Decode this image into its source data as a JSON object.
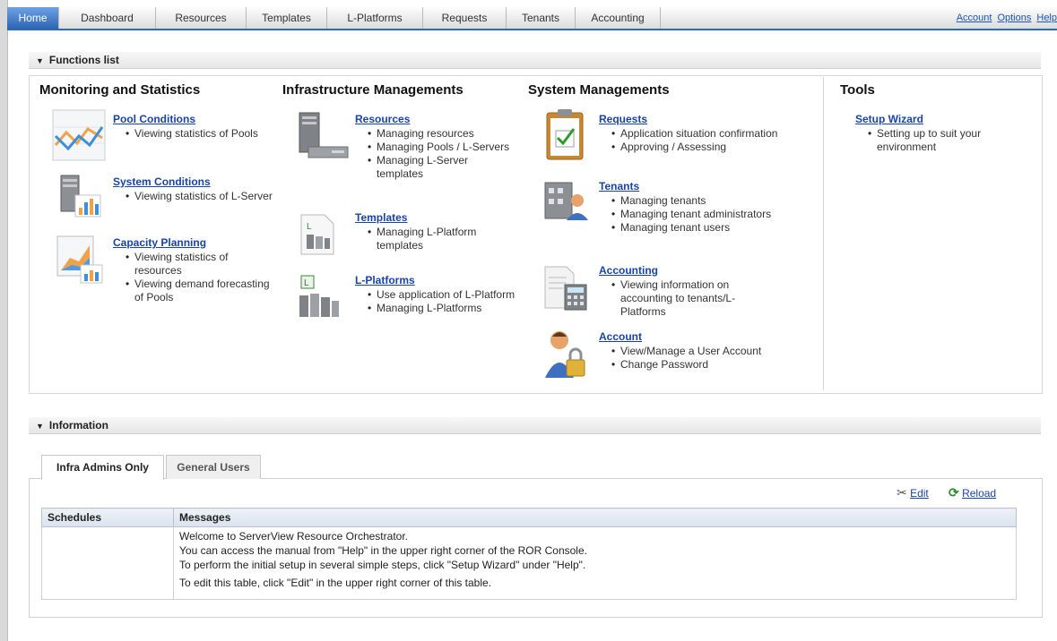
{
  "nav": {
    "tabs": [
      "Home",
      "Dashboard",
      "Resources",
      "Templates",
      "L-Platforms",
      "Requests",
      "Tenants",
      "Accounting"
    ],
    "links": [
      "Account",
      "Options",
      "Help"
    ]
  },
  "functions": {
    "header": "Functions list",
    "columns": [
      {
        "title": "Monitoring and Statistics",
        "items": [
          {
            "link": "Pool Conditions",
            "bullets": [
              "Viewing statistics of Pools"
            ],
            "icon": "line-chart-icon"
          },
          {
            "link": "System Conditions",
            "bullets": [
              "Viewing statistics of L-Server"
            ],
            "icon": "server-bar-chart-icon"
          },
          {
            "link": "Capacity Planning",
            "bullets": [
              "Viewing statistics of resources",
              "Viewing demand forecasting of Pools"
            ],
            "icon": "capacity-chart-icon"
          }
        ]
      },
      {
        "title": "Infrastructure Managements",
        "items": [
          {
            "link": "Resources",
            "bullets": [
              "Managing resources",
              "Managing Pools / L-Servers",
              "Managing L-Server templates"
            ],
            "icon": "server-tower-icon"
          },
          {
            "link": "Templates",
            "bullets": [
              "Managing L-Platform templates"
            ],
            "icon": "template-document-icon"
          },
          {
            "link": "L-Platforms",
            "bullets": [
              "Use application of L-Platform",
              "Managing L-Platforms"
            ],
            "icon": "l-platform-icon"
          }
        ]
      },
      {
        "title": "System Managements",
        "items": [
          {
            "link": "Requests",
            "bullets": [
              "Application situation confirmation",
              "Approving / Assessing"
            ],
            "icon": "clipboard-check-icon"
          },
          {
            "link": "Tenants",
            "bullets": [
              "Managing tenants",
              "Managing tenant administrators",
              "Managing tenant users"
            ],
            "icon": "building-user-icon"
          },
          {
            "link": "Accounting",
            "bullets": [
              "Viewing information on accounting to tenants/L-Platforms"
            ],
            "icon": "calculator-document-icon"
          },
          {
            "link": "Account",
            "bullets": [
              "View/Manage a User Account",
              "Change Password"
            ],
            "icon": "user-lock-icon"
          }
        ]
      },
      {
        "title": "Tools",
        "items": [
          {
            "link": "Setup Wizard",
            "bullets": [
              "Setting up to suit your environment"
            ]
          }
        ]
      }
    ]
  },
  "information": {
    "header": "Information",
    "tabs": [
      "Infra Admins Only",
      "General Users"
    ],
    "actions": {
      "edit": "Edit",
      "reload": "Reload"
    },
    "table": {
      "columns": [
        "Schedules",
        "Messages"
      ],
      "messages": [
        "Welcome to ServerView Resource Orchestrator.",
        "You can access the manual from \"Help\" in the upper right corner of the ROR Console.",
        "To perform the initial setup in several simple steps, click \"Setup Wizard\" under \"Help\".",
        "To edit this table, click \"Edit\" in the upper right corner of this table."
      ]
    }
  }
}
